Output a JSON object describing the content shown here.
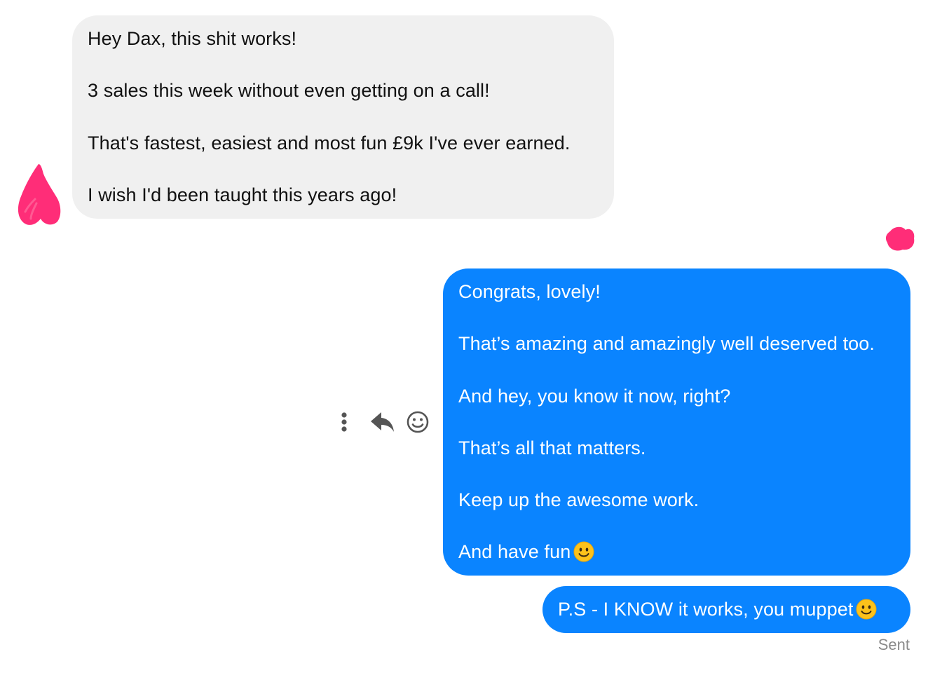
{
  "conversation": {
    "incoming": {
      "lines": [
        "Hey Dax, this shit works!",
        "3 sales this week without even getting on a call!",
        "That's fastest, easiest and most fun £9k I've ever earned.",
        "I wish I'd been taught this years ago!"
      ]
    },
    "outgoing": {
      "lines": [
        "Congrats, lovely!",
        "That’s amazing and amazingly well deserved too.",
        "And hey, you know it now, right?",
        "That’s all that matters.",
        "Keep up the awesome work.",
        "And have fun"
      ],
      "last_line_emoji": "slightly-smiling-face-emoji",
      "ps_text": "P.S - I KNOW it works, you muppet",
      "ps_emoji": "slightly-smiling-face-emoji",
      "status": "Sent"
    },
    "actions": {
      "more_icon": "more-vertical-icon",
      "reply_icon": "reply-icon",
      "react_icon": "smiley-react-icon"
    }
  },
  "colors": {
    "incoming_bubble": "#f0f0f0",
    "outgoing_bubble": "#0a84ff",
    "redaction_scribble": "#ff2d78",
    "status_text": "#8a8a8a",
    "action_icons": "#555555"
  }
}
